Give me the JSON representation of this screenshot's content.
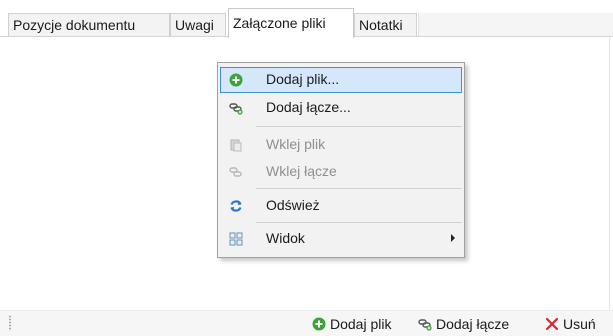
{
  "tabs": [
    {
      "label": "Pozycje dokumentu",
      "active": false
    },
    {
      "label": "Uwagi",
      "active": false
    },
    {
      "label": "Załączone pliki",
      "active": true
    },
    {
      "label": "Notatki",
      "active": false
    }
  ],
  "context_menu": {
    "items": [
      {
        "label": "Dodaj plik...",
        "icon": "add-circle-icon",
        "enabled": true,
        "highlighted": true
      },
      {
        "label": "Dodaj łącze...",
        "icon": "chain-link-icon",
        "enabled": true
      },
      {
        "label": "Wklej plik",
        "icon": "paste-icon",
        "enabled": false
      },
      {
        "label": "Wklej łącze",
        "icon": "chain-link-icon",
        "enabled": false
      },
      {
        "label": "Odśwież",
        "icon": "refresh-icon",
        "enabled": true
      },
      {
        "label": "Widok",
        "icon": "view-grid-icon",
        "enabled": true,
        "has_submenu": true
      }
    ]
  },
  "toolbar": {
    "add_file_label": "Dodaj plik",
    "add_link_label": "Dodaj łącze",
    "remove_label": "Usuń"
  },
  "colors": {
    "add_green": "#3aa33a",
    "remove_red": "#d8272c",
    "menu_highlight_fill": "#d5e8fb",
    "menu_highlight_border": "#3d8ee0",
    "refresh_blue": "#2f74c9"
  }
}
